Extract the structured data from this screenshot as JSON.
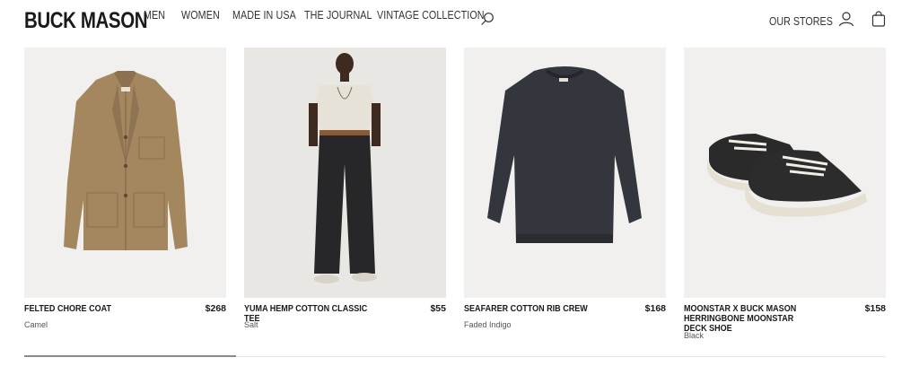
{
  "brand": {
    "logo_text": "BUCK MASON"
  },
  "nav": {
    "items": [
      {
        "label": "MEN"
      },
      {
        "label": "WOMEN"
      },
      {
        "label": "MADE IN USA"
      },
      {
        "label": "THE JOURNAL"
      },
      {
        "label": "VINTAGE COLLECTION"
      }
    ],
    "stores_label": "OUR STORES",
    "icons": [
      "search-icon",
      "account-icon",
      "bag-icon"
    ]
  },
  "products": [
    {
      "name": "FELTED CHORE COAT",
      "price": "$268",
      "color": "Camel"
    },
    {
      "name": "YUMA HEMP COTTON CLASSIC TEE",
      "price": "$55",
      "color": "Salt"
    },
    {
      "name": "SEAFARER COTTON RIB CREW",
      "price": "$168",
      "color": "Faded Indigo"
    },
    {
      "name": "MOONSTAR X BUCK MASON HERRINGBONE MOONSTAR DECK SHOE",
      "price": "$158",
      "color": "Black"
    }
  ],
  "colors": {
    "text": "#1a1a1a",
    "image_bg": "#f1f0ee",
    "scroll_thumb": "#8a8a8a"
  }
}
